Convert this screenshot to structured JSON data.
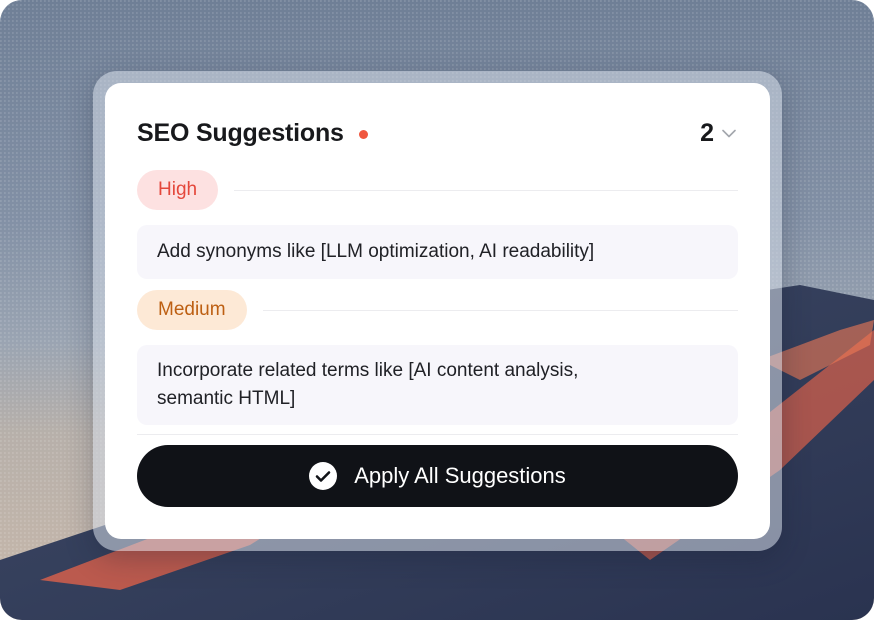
{
  "panel": {
    "title": "SEO Suggestions",
    "count": "2",
    "colors": {
      "indicator_dot": "#f0573f",
      "high_pill_bg": "#fde1e1",
      "high_pill_text": "#e4473b",
      "medium_pill_bg": "#fde9d6",
      "medium_pill_text": "#bd5f12",
      "button_bg": "#101217"
    },
    "icons": {
      "status": "dot-indicator",
      "collapse": "chevron-down-icon",
      "apply": "check-circle-icon"
    },
    "sections": [
      {
        "priority": "High",
        "suggestion": "Add synonyms like [LLM optimization, AI readability]"
      },
      {
        "priority": "Medium",
        "suggestion": "Incorporate related terms like [AI content analysis, semantic HTML]"
      }
    ],
    "apply_button": "Apply All Suggestions"
  }
}
